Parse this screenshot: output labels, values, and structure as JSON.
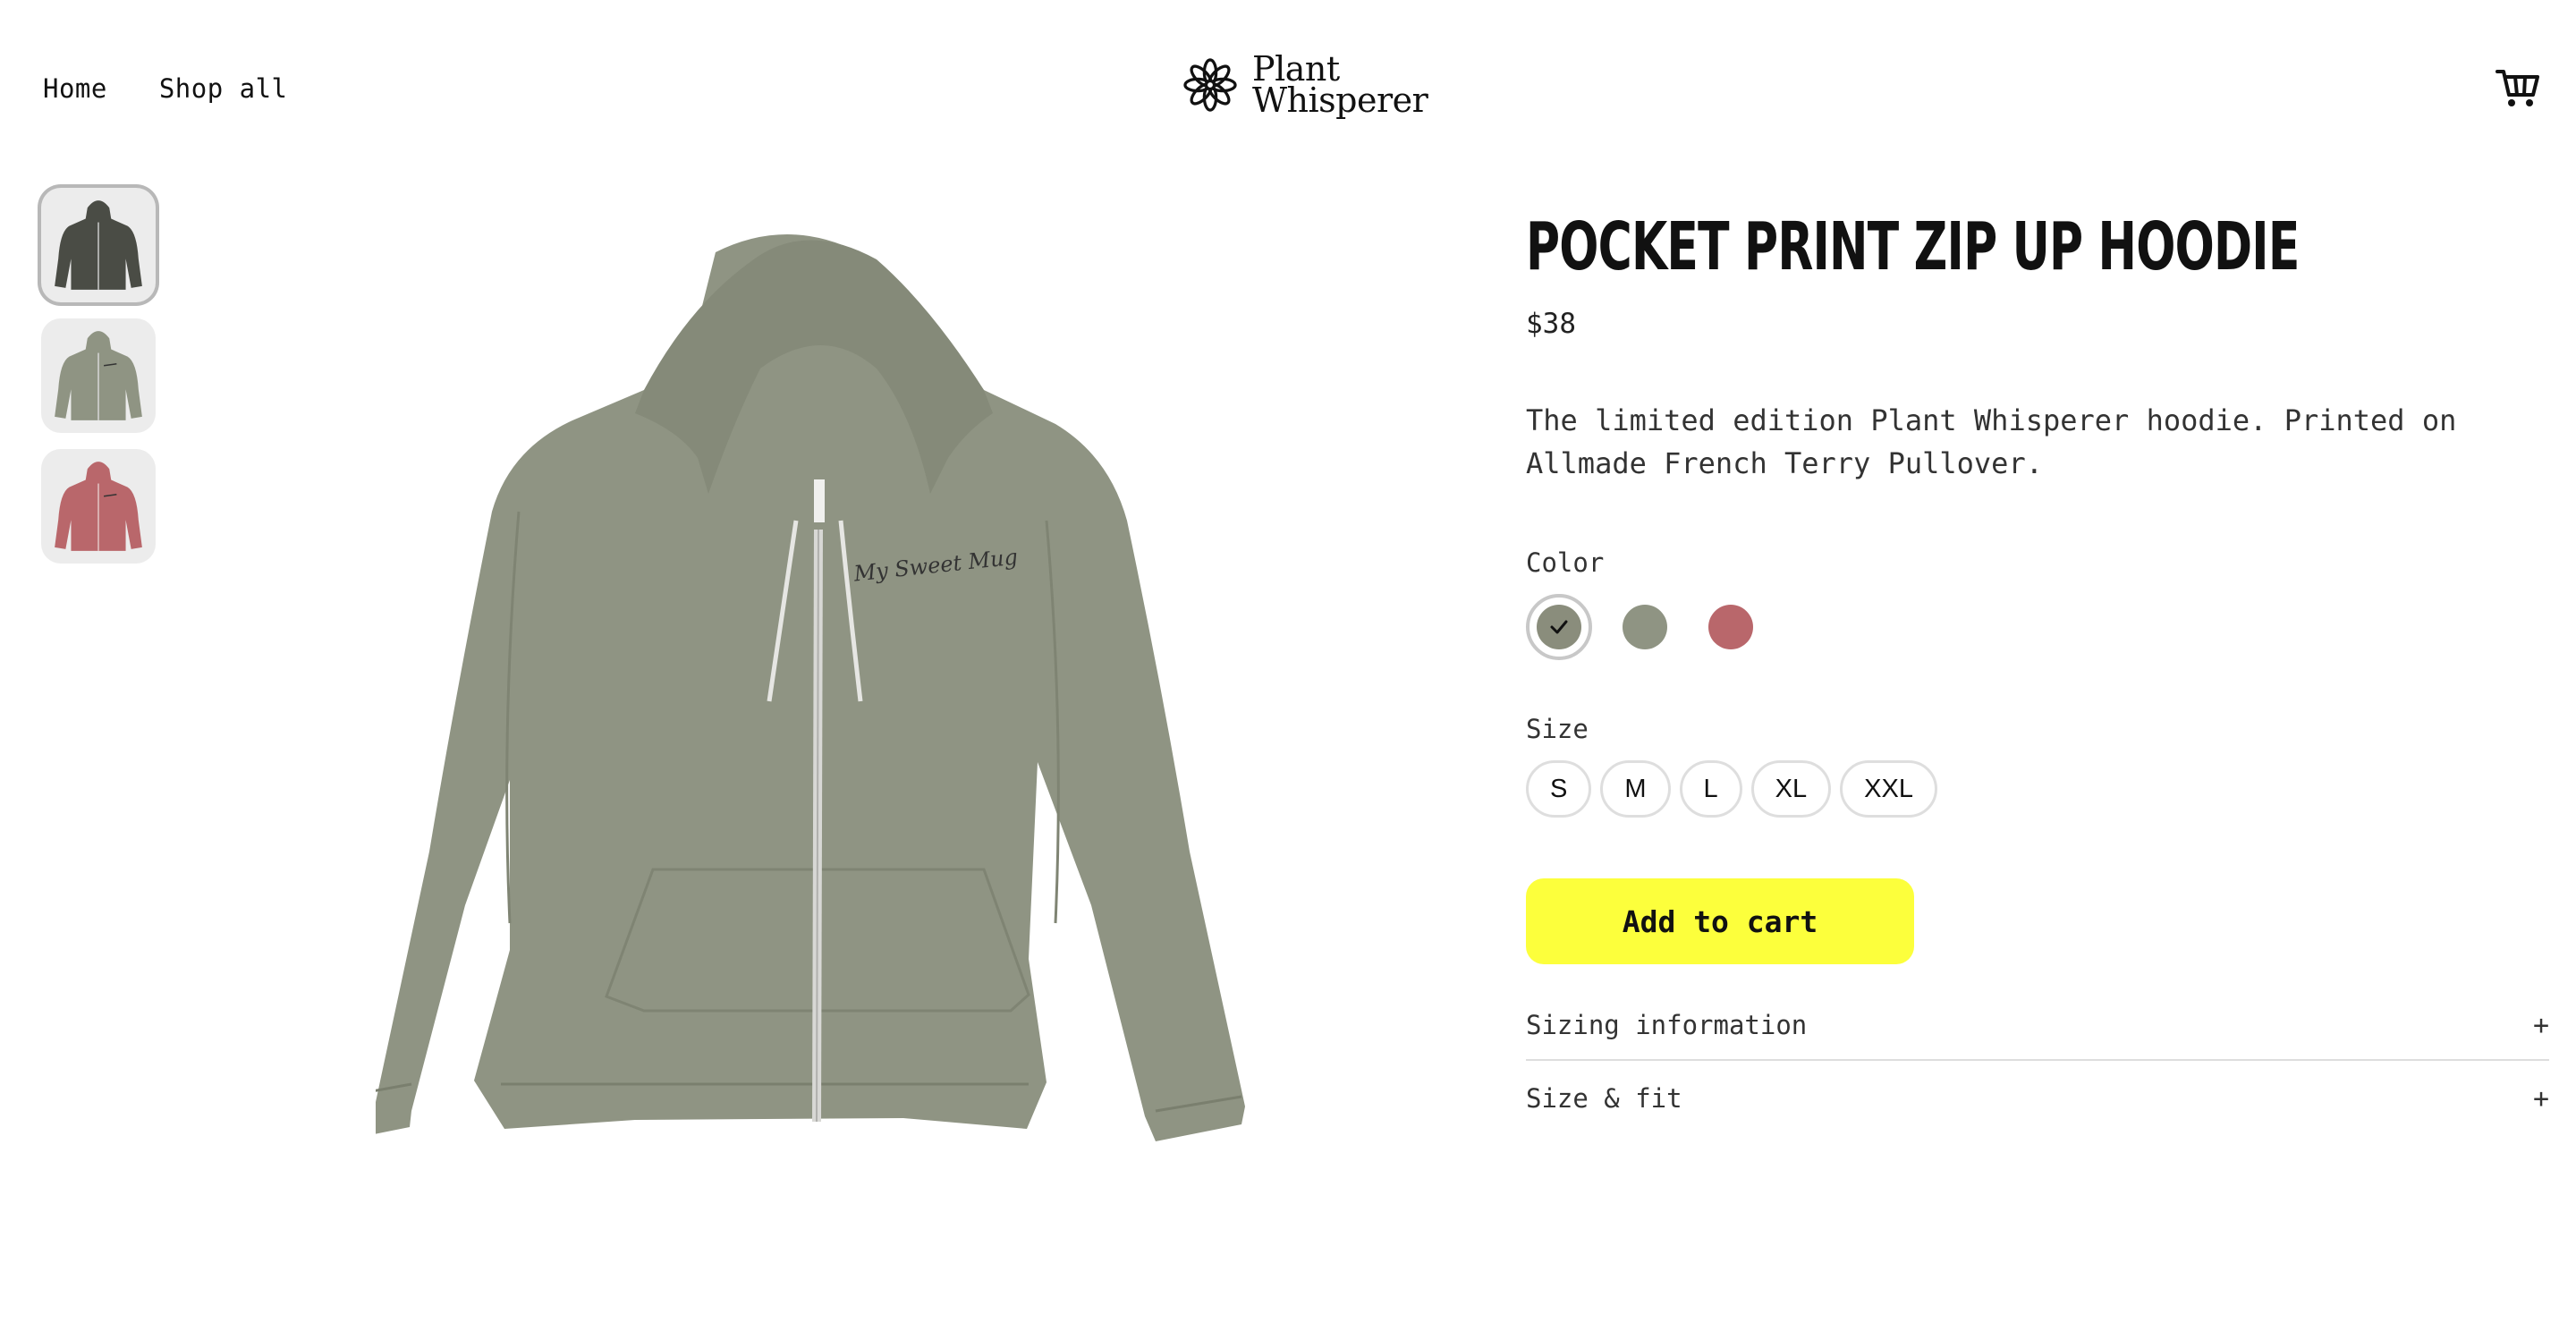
{
  "header": {
    "nav": [
      "Home",
      "Shop all"
    ],
    "logo_line1": "Plant",
    "logo_line2": "Whisperer"
  },
  "gallery": {
    "thumbnails": [
      {
        "color": "#4a4c45",
        "alt": "dark-hoodie"
      },
      {
        "color": "#8f9483",
        "alt": "sage-hoodie"
      },
      {
        "color": "#b9676b",
        "alt": "rose-hoodie"
      }
    ],
    "main_color": "#8f9483",
    "print_text": "My Sweet Mug"
  },
  "product": {
    "title": "Pocket Print Zip Up Hoodie",
    "price": "$38",
    "description": "The limited edition Plant Whisperer hoodie. Printed on Allmade French Terry Pullover.",
    "color_label": "Color",
    "colors": [
      {
        "hex": "#8a8d7c",
        "selected": true
      },
      {
        "hex": "#8f9483",
        "selected": false
      },
      {
        "hex": "#b9676b",
        "selected": false
      }
    ],
    "size_label": "Size",
    "sizes": [
      "S",
      "M",
      "L",
      "XL",
      "XXL"
    ],
    "add_to_cart": "Add to cart",
    "accordion": [
      {
        "label": "Sizing information",
        "icon": "+"
      },
      {
        "label": "Size & fit",
        "icon": "+"
      }
    ]
  },
  "colors": {
    "accent": "#fcff3c",
    "text": "#111111"
  }
}
